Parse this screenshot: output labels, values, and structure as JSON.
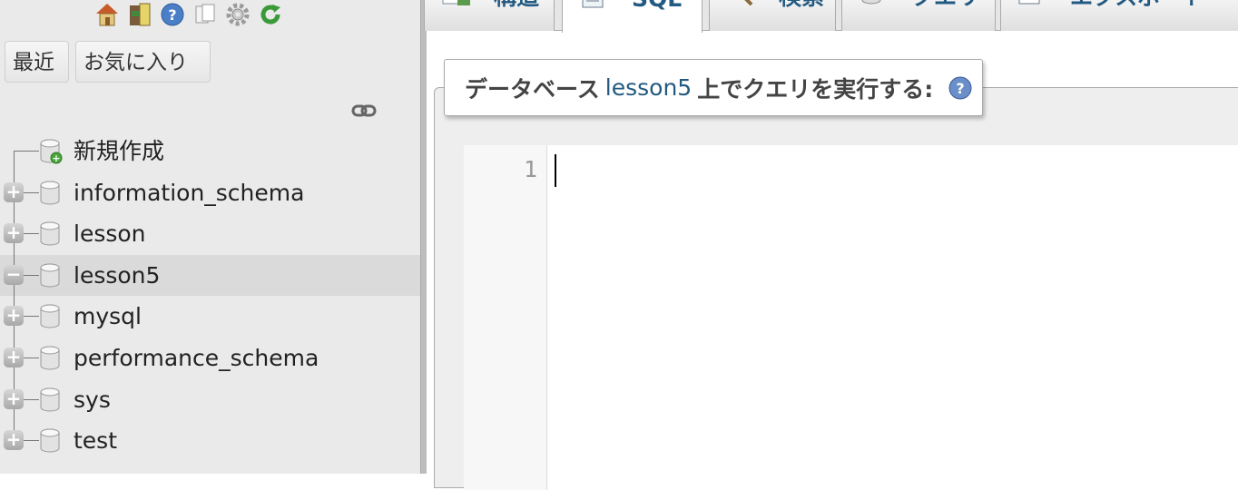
{
  "navigation": {
    "toolbar_icons": [
      "home-icon",
      "logout-icon",
      "help-icon",
      "documentation-icon",
      "settings-icon",
      "reload-icon"
    ],
    "recent_button": "最近",
    "favorites_button": "お気に入り",
    "link_icon": "chain-link-icon",
    "tree": [
      {
        "label": "新規作成",
        "type": "new"
      },
      {
        "label": "information_schema",
        "expanded": false
      },
      {
        "label": "lesson",
        "expanded": false
      },
      {
        "label": "lesson5",
        "expanded": true,
        "selected": true
      },
      {
        "label": "mysql",
        "expanded": false
      },
      {
        "label": "performance_schema",
        "expanded": false
      },
      {
        "label": "sys",
        "expanded": false
      },
      {
        "label": "test",
        "expanded": false
      }
    ],
    "expander_plus": "+",
    "expander_minus": "−"
  },
  "tabs": [
    {
      "label": "構造",
      "icon": "structure-icon"
    },
    {
      "label": "SQL",
      "icon": "sql-icon",
      "active": true
    },
    {
      "label": "検索",
      "icon": "search-icon"
    },
    {
      "label": "クエリ",
      "icon": "query-icon"
    },
    {
      "label": "エクスポート",
      "icon": "export-icon"
    }
  ],
  "query": {
    "legend_prefix": "データベース",
    "database": "lesson5",
    "legend_suffix": "上でクエリを実行する:",
    "help_icon": "help-icon",
    "line_number": "1",
    "content": ""
  },
  "colors": {
    "accent": "#235a81",
    "nav_background": "#eaeaea",
    "selected_row": "#dadada"
  }
}
